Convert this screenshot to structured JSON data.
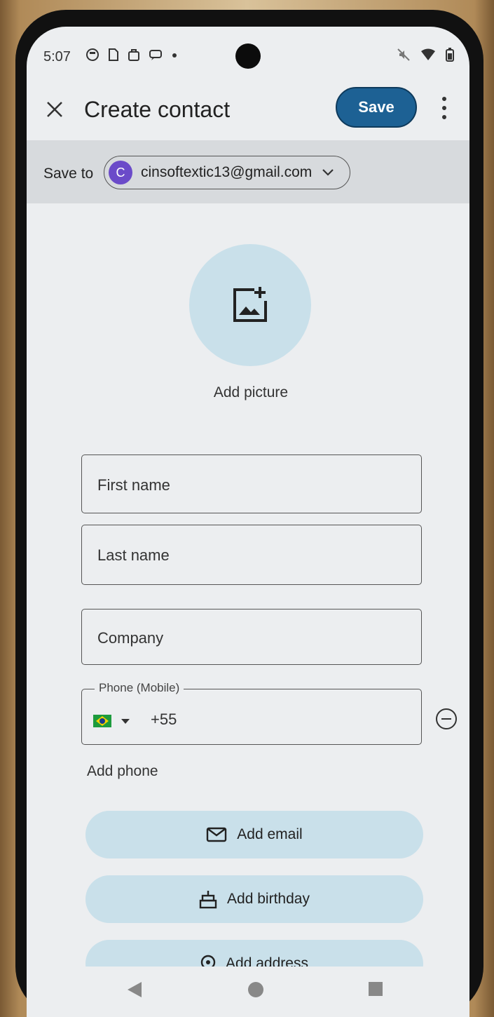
{
  "status_bar": {
    "time": "5:07",
    "icons": [
      "notification-icon",
      "sim-icon",
      "bag-icon",
      "chat-icon",
      "dot-icon"
    ],
    "right_icons": [
      "mute-icon",
      "wifi-icon",
      "battery-icon"
    ]
  },
  "toolbar": {
    "title": "Create contact",
    "save_label": "Save"
  },
  "save_to": {
    "label": "Save to",
    "avatar_letter": "C",
    "account": "cinsoftextic13@gmail.com"
  },
  "picture": {
    "label": "Add picture"
  },
  "form": {
    "first_name_placeholder": "First name",
    "last_name_placeholder": "Last name",
    "company_placeholder": "Company",
    "phone_label": "Phone (Mobile)",
    "phone_value": "+55",
    "add_phone": "Add phone"
  },
  "actions": {
    "add_email": "Add email",
    "add_birthday": "Add birthday",
    "add_address": "Add address"
  },
  "colors": {
    "accent": "#1d6194",
    "pill_bg": "#c9e0ea",
    "avatar": "#6b4bc9"
  }
}
